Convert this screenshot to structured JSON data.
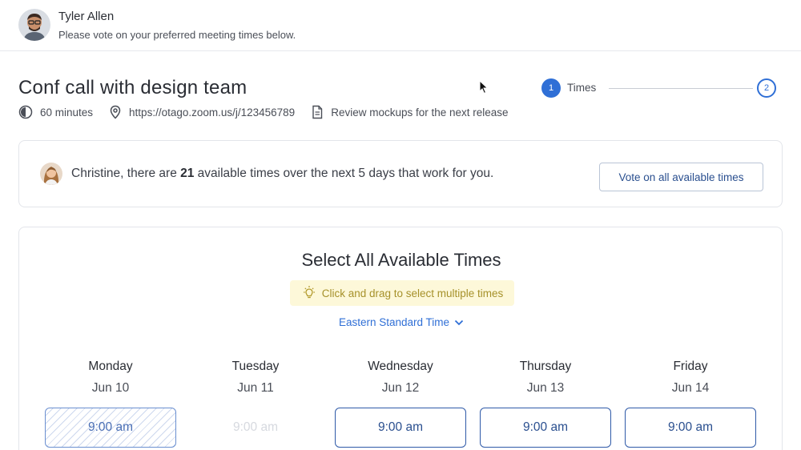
{
  "header": {
    "host_name": "Tyler Allen",
    "subtitle": "Please vote on your preferred meeting times below."
  },
  "meeting": {
    "title": "Conf call with design team",
    "duration": "60 minutes",
    "location": "https://otago.zoom.us/j/123456789",
    "note": "Review mockups for the next release"
  },
  "stepper": {
    "step1_number": "1",
    "step1_label": "Times",
    "step2_number": "2"
  },
  "suggestion": {
    "prefix": "Christine, there are ",
    "count": "21",
    "suffix": " available times over the next 5 days that work for you.",
    "button_label": "Vote on all available times"
  },
  "times": {
    "title": "Select All Available Times",
    "hint": "Click and drag to select multiple times",
    "timezone": "Eastern Standard Time",
    "days": [
      {
        "name": "Monday",
        "date": "Jun 10",
        "slot": "9:00 am",
        "state": "selected"
      },
      {
        "name": "Tuesday",
        "date": "Jun 11",
        "slot": "9:00 am",
        "state": "disabled"
      },
      {
        "name": "Wednesday",
        "date": "Jun 12",
        "slot": "9:00 am",
        "state": "available"
      },
      {
        "name": "Thursday",
        "date": "Jun 13",
        "slot": "9:00 am",
        "state": "available"
      },
      {
        "name": "Friday",
        "date": "Jun 14",
        "slot": "9:00 am",
        "state": "available"
      }
    ]
  },
  "colors": {
    "accent": "#2f6fd6",
    "hint_bg": "#fdf8d9",
    "hint_text": "#a6912a"
  },
  "icons": [
    "clock-icon",
    "location-pin-icon",
    "document-icon",
    "lightbulb-icon",
    "chevron-down-icon"
  ]
}
